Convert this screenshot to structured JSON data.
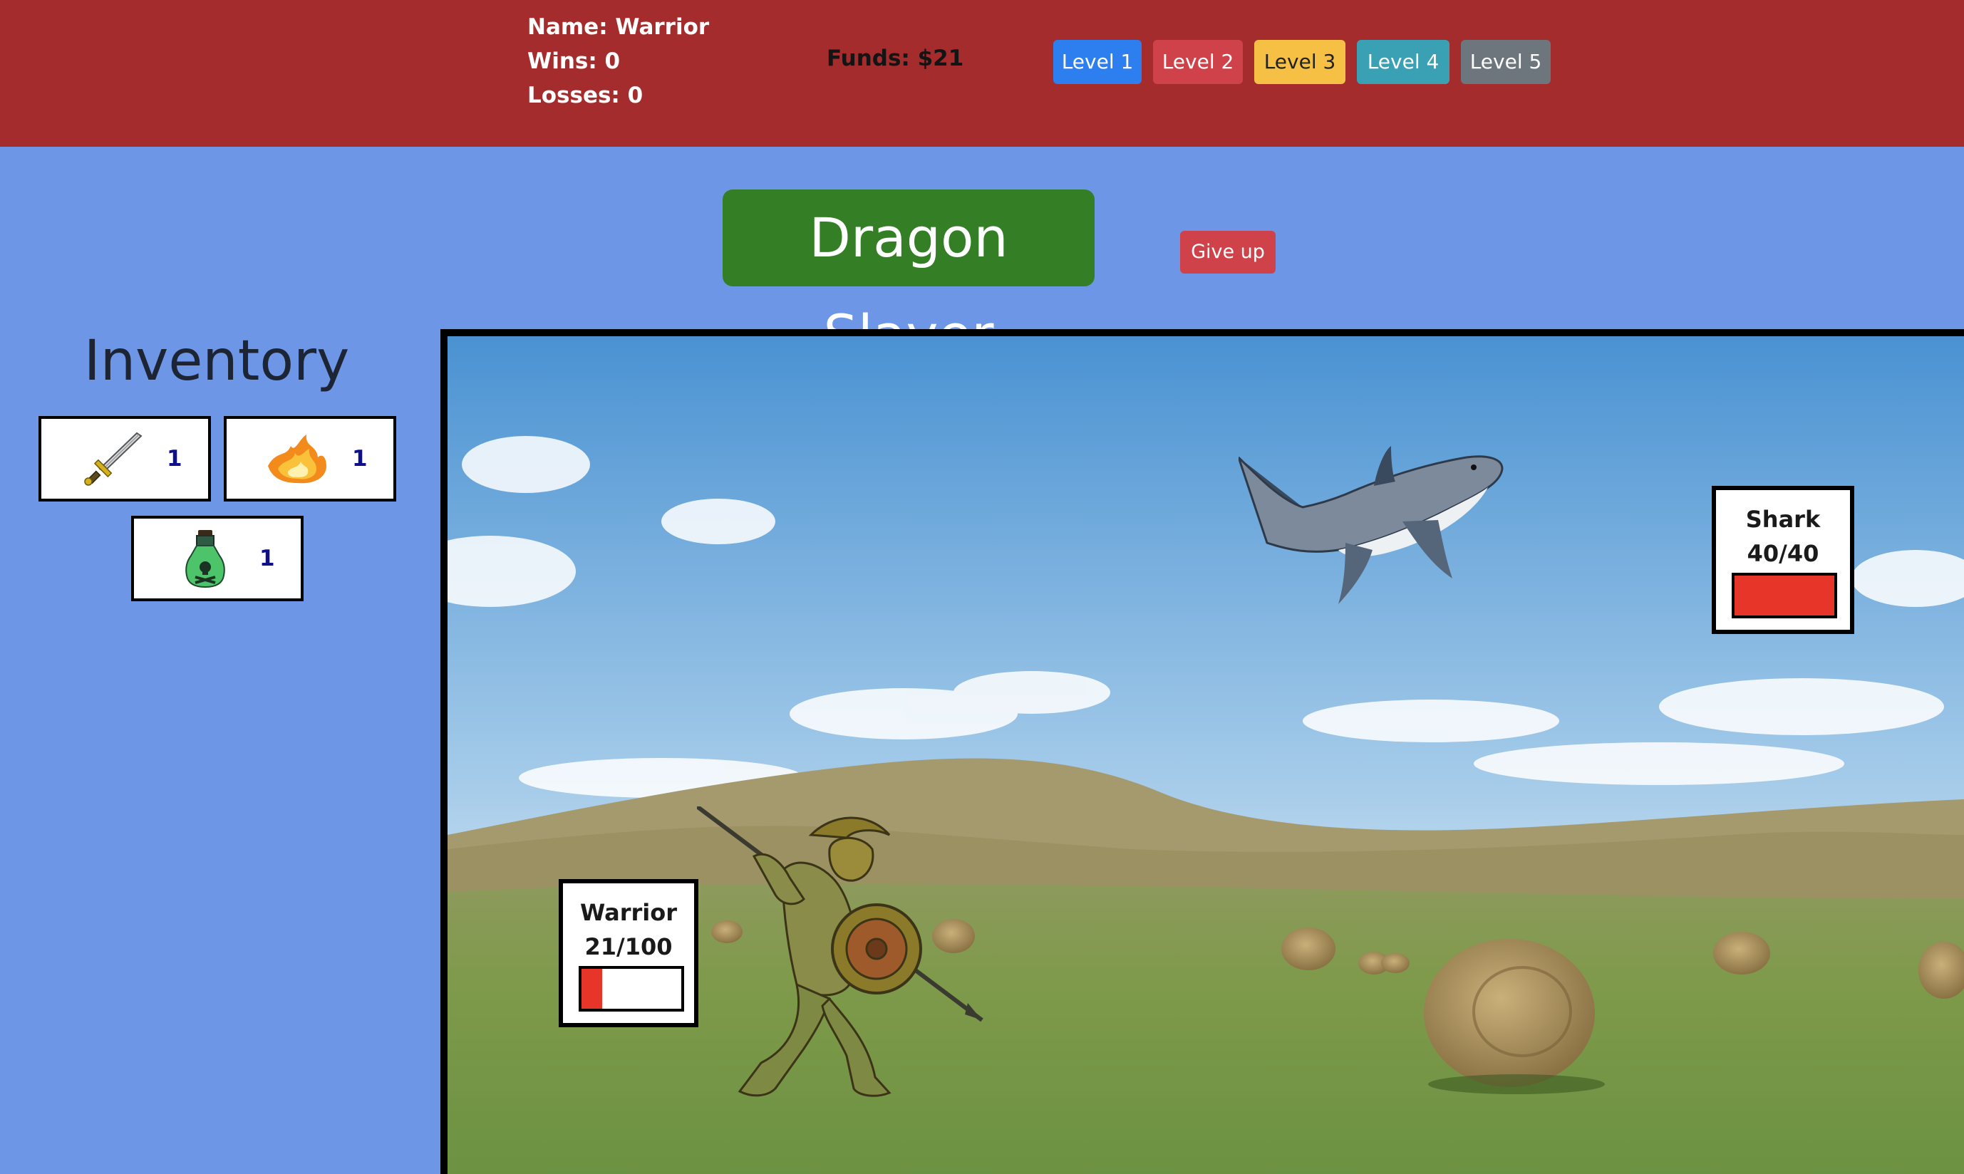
{
  "header": {
    "name_label": "Name: Warrior",
    "wins_label": "Wins: 0",
    "losses_label": "Losses: 0",
    "funds_label": "Funds: $21",
    "levels": [
      {
        "label": "Level 1",
        "color": "#2d7ff0"
      },
      {
        "label": "Level 2",
        "color": "#d0424a"
      },
      {
        "label": "Level 3",
        "color": "#f5c044"
      },
      {
        "label": "Level 4",
        "color": "#3aa0b3"
      },
      {
        "label": "Level 5",
        "color": "#6d757d"
      }
    ]
  },
  "game": {
    "title": "Dragon Slayer",
    "give_up_label": "Give up"
  },
  "inventory": {
    "title": "Inventory",
    "items": [
      {
        "icon": "sword-icon",
        "count": "1"
      },
      {
        "icon": "fireball-icon",
        "count": "1"
      },
      {
        "icon": "poison-potion-icon",
        "count": "1"
      }
    ]
  },
  "battle": {
    "player": {
      "name": "Warrior",
      "hp_text": "21/100",
      "hp_fraction": 0.21
    },
    "enemy": {
      "name": "Shark",
      "hp_text": "40/40",
      "hp_fraction": 1.0
    }
  },
  "colors": {
    "header_bg": "#a52c2c",
    "page_bg": "#6d96e6",
    "title_bg": "#347f25",
    "hp_bar": "#e8352a"
  }
}
